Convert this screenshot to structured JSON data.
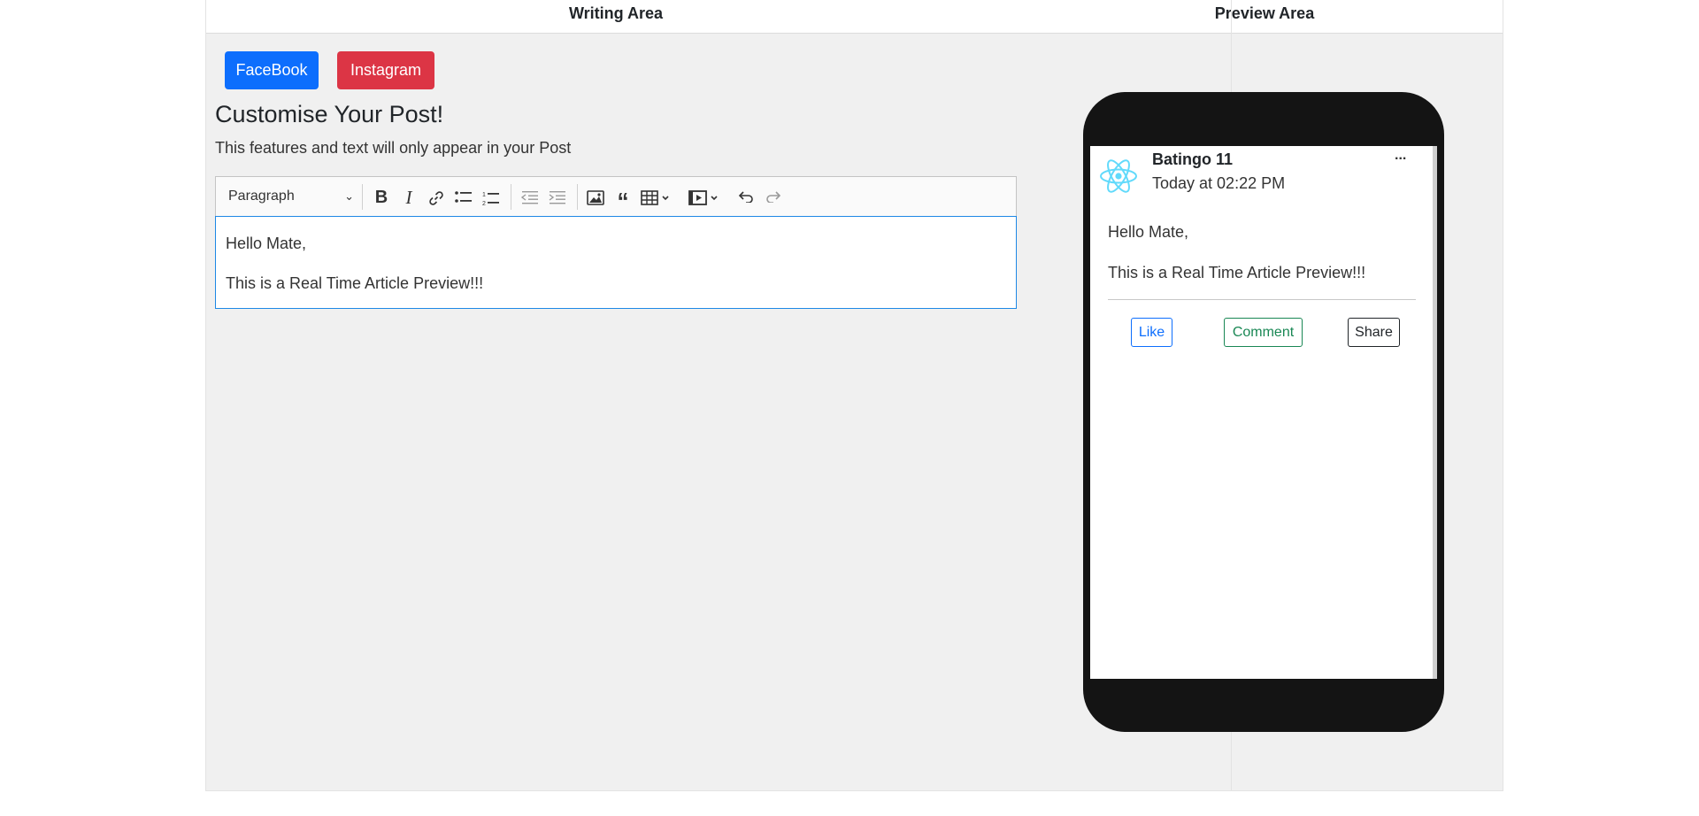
{
  "columns": {
    "writing": "Writing Area",
    "preview": "Preview Area"
  },
  "platforms": {
    "facebook": "FaceBook",
    "instagram": "Instagram"
  },
  "editor": {
    "heading": "Customise Your Post!",
    "subtitle": "This features and text will only appear in your Post",
    "block_format": "Paragraph",
    "content": [
      "Hello Mate,",
      "This is a Real Time Article Preview!!!"
    ]
  },
  "toolbar_icons": [
    "bold-icon",
    "italic-icon",
    "link-icon",
    "bulleted-list-icon",
    "numbered-list-icon",
    "outdent-icon",
    "indent-icon",
    "image-icon",
    "quote-icon",
    "table-icon",
    "media-icon",
    "undo-icon",
    "redo-icon"
  ],
  "preview": {
    "name": "Batingo 11",
    "time": "Today at 02:22 PM",
    "more": "...",
    "body": [
      "Hello Mate,",
      "This is a Real Time Article Preview!!!"
    ],
    "actions": {
      "like": "Like",
      "comment": "Comment",
      "share": "Share"
    }
  },
  "colors": {
    "facebook": "#0d6efd",
    "instagram": "#dc3545",
    "like": "#0d6efd",
    "comment": "#198754",
    "react_logo": "#61dafb"
  }
}
